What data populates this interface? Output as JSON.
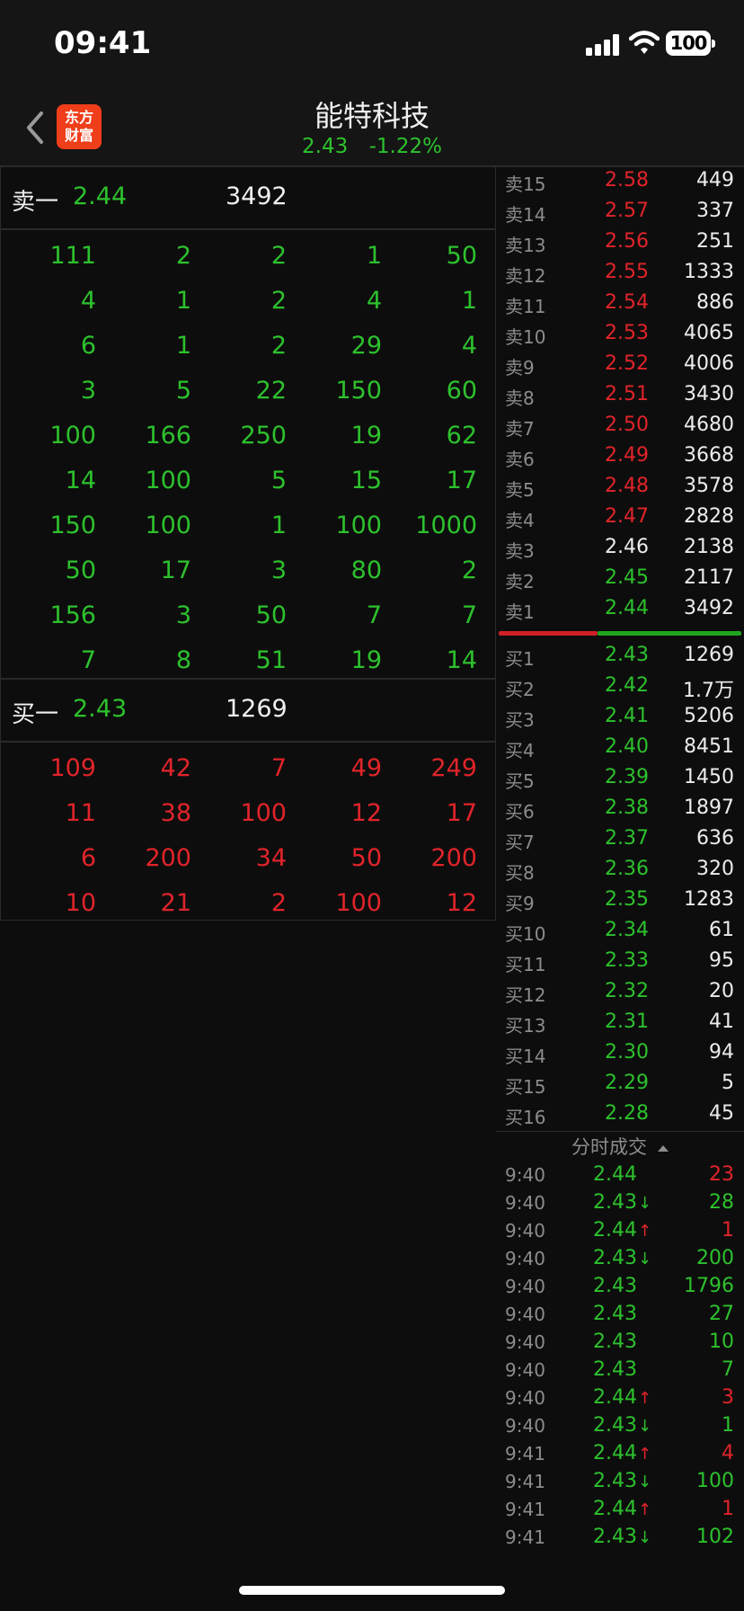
{
  "status_bar": {
    "time": "09:41",
    "battery": "100"
  },
  "header": {
    "logo_text": "东方财富",
    "title": "能特科技",
    "price": "2.43",
    "change_pct": "-1.22%"
  },
  "ask_summary": {
    "label": "卖一",
    "price": "2.44",
    "volume": "3492"
  },
  "ask_queue": [
    [
      "111",
      "2",
      "2",
      "1",
      "50"
    ],
    [
      "4",
      "1",
      "2",
      "4",
      "1"
    ],
    [
      "6",
      "1",
      "2",
      "29",
      "4"
    ],
    [
      "3",
      "5",
      "22",
      "150",
      "60"
    ],
    [
      "100",
      "166",
      "250",
      "19",
      "62"
    ],
    [
      "14",
      "100",
      "5",
      "15",
      "17"
    ],
    [
      "150",
      "100",
      "1",
      "100",
      "1000"
    ],
    [
      "50",
      "17",
      "3",
      "80",
      "2"
    ],
    [
      "156",
      "3",
      "50",
      "7",
      "7"
    ],
    [
      "7",
      "8",
      "51",
      "19",
      "14"
    ]
  ],
  "bid_summary": {
    "label": "买一",
    "price": "2.43",
    "volume": "1269"
  },
  "bid_queue": [
    [
      "109",
      "42",
      "7",
      "49",
      "249"
    ],
    [
      "11",
      "38",
      "100",
      "12",
      "17"
    ],
    [
      "6",
      "200",
      "34",
      "50",
      "200"
    ],
    [
      "10",
      "21",
      "2",
      "100",
      "12"
    ]
  ],
  "colors": {
    "up": "#e0242a",
    "down": "#2dc12d",
    "flat": "#ececec"
  },
  "asks": [
    {
      "level": "卖15",
      "price": "2.58",
      "volume": "449",
      "dir": "red"
    },
    {
      "level": "卖14",
      "price": "2.57",
      "volume": "337",
      "dir": "red"
    },
    {
      "level": "卖13",
      "price": "2.56",
      "volume": "251",
      "dir": "red"
    },
    {
      "level": "卖12",
      "price": "2.55",
      "volume": "1333",
      "dir": "red"
    },
    {
      "level": "卖11",
      "price": "2.54",
      "volume": "886",
      "dir": "red"
    },
    {
      "level": "卖10",
      "price": "2.53",
      "volume": "4065",
      "dir": "red"
    },
    {
      "level": "卖9",
      "price": "2.52",
      "volume": "4006",
      "dir": "red"
    },
    {
      "level": "卖8",
      "price": "2.51",
      "volume": "3430",
      "dir": "red"
    },
    {
      "level": "卖7",
      "price": "2.50",
      "volume": "4680",
      "dir": "red"
    },
    {
      "level": "卖6",
      "price": "2.49",
      "volume": "3668",
      "dir": "red"
    },
    {
      "level": "卖5",
      "price": "2.48",
      "volume": "3578",
      "dir": "red"
    },
    {
      "level": "卖4",
      "price": "2.47",
      "volume": "2828",
      "dir": "red"
    },
    {
      "level": "卖3",
      "price": "2.46",
      "volume": "2138",
      "dir": "white"
    },
    {
      "level": "卖2",
      "price": "2.45",
      "volume": "2117",
      "dir": "green"
    },
    {
      "level": "卖1",
      "price": "2.44",
      "volume": "3492",
      "dir": "green"
    }
  ],
  "bids": [
    {
      "level": "买1",
      "price": "2.43",
      "volume": "1269",
      "dir": "green"
    },
    {
      "level": "买2",
      "price": "2.42",
      "volume": "1.7万",
      "dir": "green"
    },
    {
      "level": "买3",
      "price": "2.41",
      "volume": "5206",
      "dir": "green"
    },
    {
      "level": "买4",
      "price": "2.40",
      "volume": "8451",
      "dir": "green"
    },
    {
      "level": "买5",
      "price": "2.39",
      "volume": "1450",
      "dir": "green"
    },
    {
      "level": "买6",
      "price": "2.38",
      "volume": "1897",
      "dir": "green"
    },
    {
      "level": "买7",
      "price": "2.37",
      "volume": "636",
      "dir": "green"
    },
    {
      "level": "买8",
      "price": "2.36",
      "volume": "320",
      "dir": "green"
    },
    {
      "level": "买9",
      "price": "2.35",
      "volume": "1283",
      "dir": "green"
    },
    {
      "level": "买10",
      "price": "2.34",
      "volume": "61",
      "dir": "green"
    },
    {
      "level": "买11",
      "price": "2.33",
      "volume": "95",
      "dir": "green"
    },
    {
      "level": "买12",
      "price": "2.32",
      "volume": "20",
      "dir": "green"
    },
    {
      "level": "买13",
      "price": "2.31",
      "volume": "41",
      "dir": "green"
    },
    {
      "level": "买14",
      "price": "2.30",
      "volume": "94",
      "dir": "green"
    },
    {
      "level": "买15",
      "price": "2.29",
      "volume": "5",
      "dir": "green"
    },
    {
      "level": "买16",
      "price": "2.28",
      "volume": "45",
      "dir": "green"
    }
  ],
  "ticks_header": "分时成交",
  "ticks": [
    {
      "time": "9:40",
      "price": "2.44",
      "arrow": "",
      "volume": "23",
      "vcolor": "red"
    },
    {
      "time": "9:40",
      "price": "2.43",
      "arrow": "↓",
      "volume": "28",
      "vcolor": "green"
    },
    {
      "time": "9:40",
      "price": "2.44",
      "arrow": "↑",
      "volume": "1",
      "vcolor": "red"
    },
    {
      "time": "9:40",
      "price": "2.43",
      "arrow": "↓",
      "volume": "200",
      "vcolor": "green"
    },
    {
      "time": "9:40",
      "price": "2.43",
      "arrow": "",
      "volume": "1796",
      "vcolor": "green"
    },
    {
      "time": "9:40",
      "price": "2.43",
      "arrow": "",
      "volume": "27",
      "vcolor": "green"
    },
    {
      "time": "9:40",
      "price": "2.43",
      "arrow": "",
      "volume": "10",
      "vcolor": "green"
    },
    {
      "time": "9:40",
      "price": "2.43",
      "arrow": "",
      "volume": "7",
      "vcolor": "green"
    },
    {
      "time": "9:40",
      "price": "2.44",
      "arrow": "↑",
      "volume": "3",
      "vcolor": "red"
    },
    {
      "time": "9:40",
      "price": "2.43",
      "arrow": "↓",
      "volume": "1",
      "vcolor": "green"
    },
    {
      "time": "9:41",
      "price": "2.44",
      "arrow": "↑",
      "volume": "4",
      "vcolor": "red"
    },
    {
      "time": "9:41",
      "price": "2.43",
      "arrow": "↓",
      "volume": "100",
      "vcolor": "green"
    },
    {
      "time": "9:41",
      "price": "2.44",
      "arrow": "↑",
      "volume": "1",
      "vcolor": "red"
    },
    {
      "time": "9:41",
      "price": "2.43",
      "arrow": "↓",
      "volume": "102",
      "vcolor": "green"
    }
  ]
}
